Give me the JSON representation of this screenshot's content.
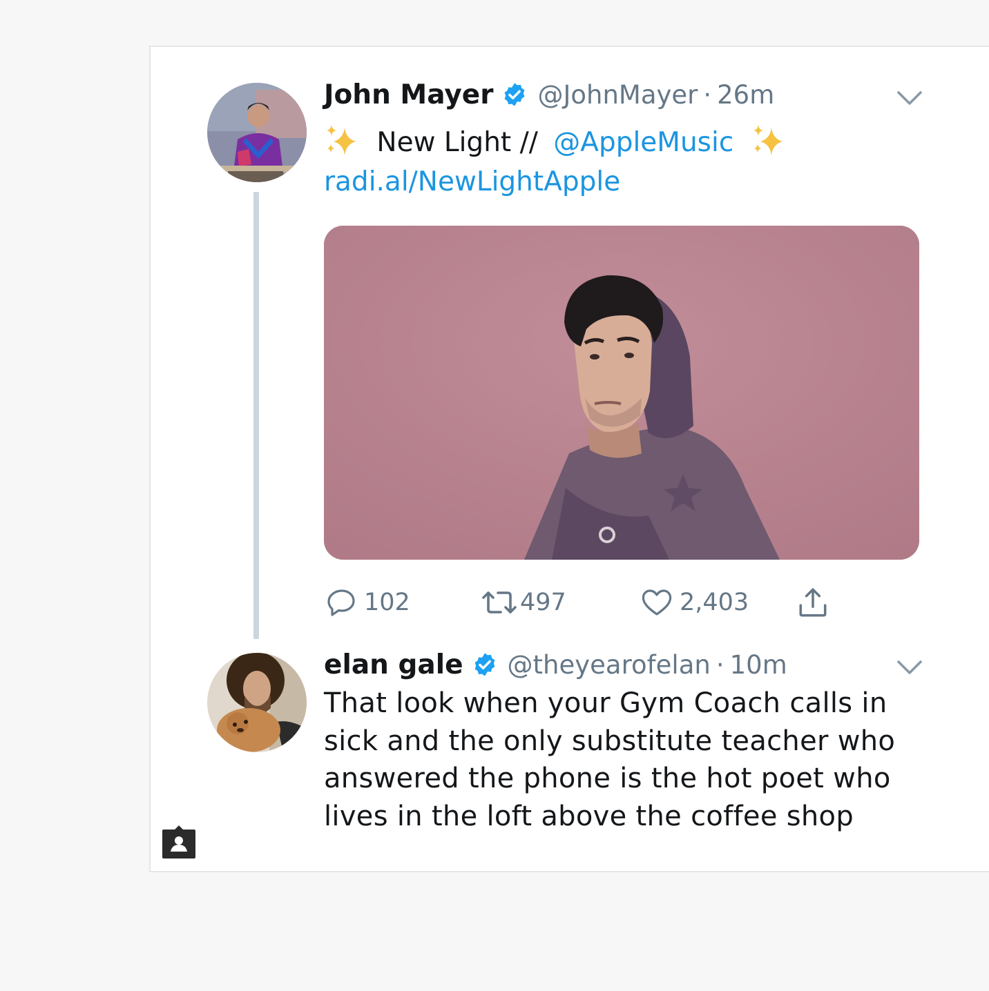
{
  "tweets": [
    {
      "display_name": "John Mayer",
      "verified_icon": "verified-badge-icon",
      "handle": "@JohnMayer",
      "separator": "·",
      "time": "26m",
      "text_prefix": "New Light //",
      "mention": "@AppleMusic",
      "link": "radi.al/NewLightApple",
      "emoji": "sparkles-icon",
      "media_icon": "photo-portrait",
      "actions": {
        "reply_count": "102",
        "retweet_count": "497",
        "like_count": "2,403"
      }
    },
    {
      "display_name": "elan gale",
      "verified_icon": "verified-badge-icon",
      "handle": "@theyearofelan",
      "separator": "·",
      "time": "10m",
      "text_lines": [
        "That look when your Gym Coach calls in",
        "sick and the only substitute teacher who",
        "answered the phone is the hot poet who",
        "lives in the loft above the coffee shop"
      ]
    }
  ],
  "colors": {
    "link": "#1b95e0",
    "verified": "#1da1f2",
    "muted": "#657786",
    "thread_line": "#ccd6dd",
    "media_background": "#b88390"
  }
}
